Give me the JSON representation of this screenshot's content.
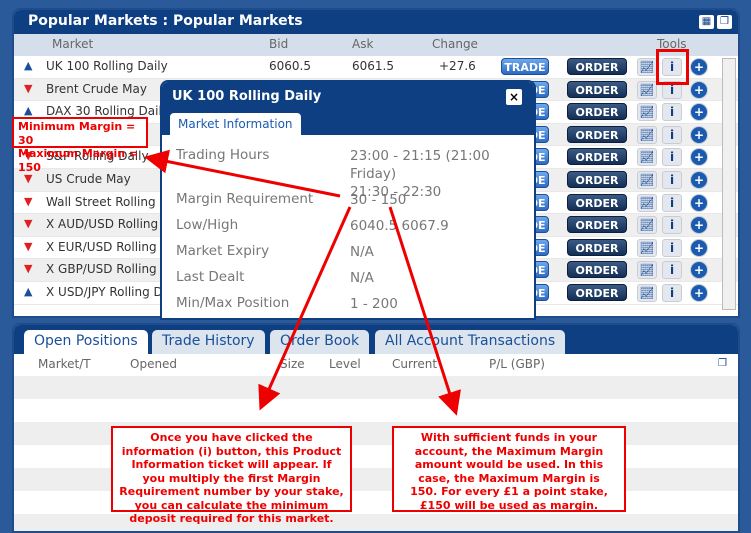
{
  "markets_panel": {
    "title": "Popular Markets : Popular Markets",
    "columns": {
      "market": "Market",
      "bid": "Bid",
      "ask": "Ask",
      "change": "Change",
      "tools": "Tools"
    },
    "rows": [
      {
        "market": "UK 100 Rolling Daily",
        "dir": "up",
        "bid": "6060.5",
        "ask": "6061.5",
        "change": "+27.6"
      },
      {
        "market": "Brent Crude May",
        "dir": "down"
      },
      {
        "market": "DAX 30 Rolling Daily",
        "dir": "up"
      },
      {
        "market": "",
        "dir": "down"
      },
      {
        "market": "S&P Rolling Daily",
        "dir": "down"
      },
      {
        "market": "US Crude  May",
        "dir": "down"
      },
      {
        "market": "Wall Street Rolling D",
        "dir": "down"
      },
      {
        "market": "X AUD/USD Rolling D",
        "dir": "down"
      },
      {
        "market": "X EUR/USD Rolling D",
        "dir": "down"
      },
      {
        "market": "X GBP/USD Rolling D",
        "dir": "down"
      },
      {
        "market": "X USD/JPY Rolling Da",
        "dir": "up"
      }
    ],
    "trade_label": "TRADE",
    "order_label": "ORDER"
  },
  "popup": {
    "title": "UK 100 Rolling Daily",
    "close": "×",
    "tab": "Market Information",
    "fields": [
      {
        "label": "Trading Hours",
        "value": "23:00 - 21:15 (21:00 Friday)\n21:30 - 22:30"
      },
      {
        "label": "Margin Requirement",
        "value": "30 - 150"
      },
      {
        "label": "Low/High",
        "value": "6040.5  6067.9"
      },
      {
        "label": "Market Expiry",
        "value": "N/A"
      },
      {
        "label": "Last Dealt",
        "value": "N/A"
      },
      {
        "label": "Min/Max Position",
        "value": "1 - 200"
      }
    ]
  },
  "positions_panel": {
    "tabs": [
      "Open Positions",
      "Trade History",
      "Order Book",
      "All Account Transactions"
    ],
    "columns": [
      "Market/T",
      "Opened",
      "Size",
      "Level",
      "Current",
      "P/L (GBP)"
    ]
  },
  "annotations": {
    "margin_box": "Minimum Margin = 30\nMaximum Margin = 150",
    "note_left": "Once you have clicked the information (i) button, this Product Information ticket will appear.  If you multiply the first Margin Requirement number by your stake, you can calculate the minimum deposit required for this market.",
    "note_right": "With sufficient funds in your account, the Maximum Margin amount would be used.  In this case, the Maximum Margin is 150.  For every £1 a point stake, £150 will be used as margin.",
    "color": "#e00000"
  }
}
